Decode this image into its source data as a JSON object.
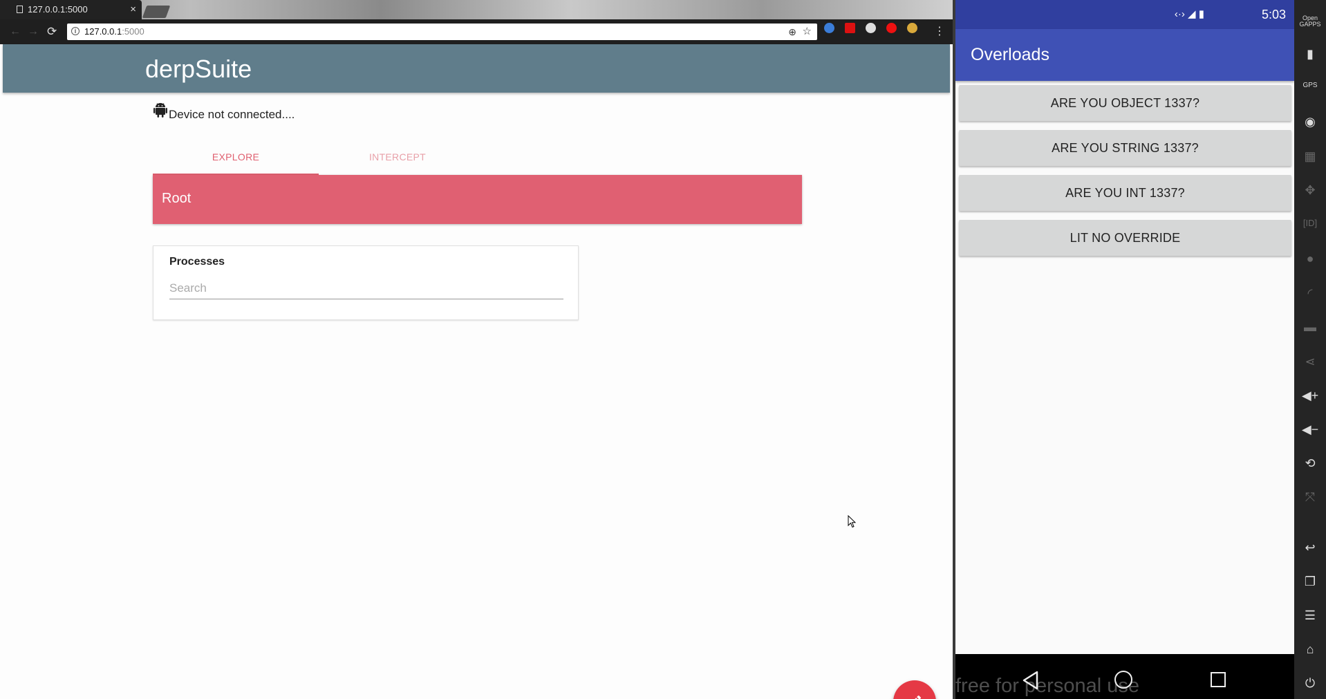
{
  "browser": {
    "tab_title": "127.0.0.1:5000",
    "tab_close": "×",
    "url_host": "127.0.0.1",
    "url_port": ":5000",
    "menu": "⋮",
    "nav": {
      "back": "←",
      "forward": "→",
      "reload": "⟳"
    },
    "extension_colors": [
      "#3b7dd8",
      "#d11",
      "#ddd",
      "#e11",
      "#d9a93b"
    ]
  },
  "page": {
    "brand": "derpSuite",
    "device_status": "Device not connected....",
    "tabs": [
      {
        "label": "EXPLORE",
        "active": true
      },
      {
        "label": "INTERCEPT",
        "active": false
      }
    ],
    "root_label": "Root",
    "processes_card": {
      "title": "Processes",
      "search_placeholder": "Search"
    },
    "accent_color": "#e06072",
    "appbar_color": "#607d8b",
    "fab_color": "#e53945"
  },
  "emulator": {
    "time": "5:03",
    "status_icons": "‹·› ◢ ▮",
    "app_title": "Overloads",
    "buttons": [
      "ARE YOU OBJECT 1337?",
      "ARE YOU STRING 1337?",
      "ARE YOU INT 1337?",
      "LIT NO OVERRIDE"
    ],
    "watermark": "free for personal use",
    "side_toolbar": {
      "top_label": "Open GAPPS",
      "items": [
        "battery-icon",
        "gps-icon",
        "camera-icon",
        "video-icon",
        "move-icon",
        "id-icon",
        "fingerprint-icon",
        "rss-icon",
        "message-icon",
        "share-icon",
        "volume-up-icon",
        "volume-down-icon",
        "rotate-icon",
        "resize-icon",
        "back-icon",
        "recents-icon",
        "menu-icon",
        "home-icon",
        "power-icon"
      ]
    }
  }
}
